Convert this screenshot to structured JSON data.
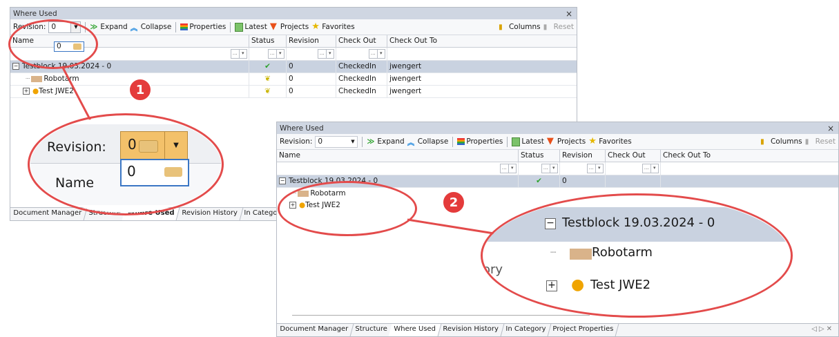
{
  "panel1": {
    "title": "Where Used",
    "close": "×",
    "toolbar": {
      "revision_label": "Revision:",
      "revision_value": "0",
      "expand": "Expand",
      "collapse": "Collapse",
      "properties": "Properties",
      "latest": "Latest",
      "projects": "Projects",
      "favorites": "Favorites",
      "columns": "Columns",
      "reset": "Reset"
    },
    "dropdown_option": "0",
    "columns": [
      "Name",
      "Status",
      "Revision",
      "Check Out",
      "Check Out To"
    ],
    "rows": [
      {
        "name": "Testblock 19.03.2024 - 0",
        "revision": "0",
        "checkout": "CheckedIn",
        "checkout_to": "jwengert"
      },
      {
        "name": "Robotarm",
        "revision": "0",
        "checkout": "CheckedIn",
        "checkout_to": "jwengert"
      },
      {
        "name": "Test JWE2",
        "revision": "0",
        "checkout": "CheckedIn",
        "checkout_to": "jwengert"
      }
    ],
    "tabs": [
      "Document Manager",
      "Structure",
      "Where Used",
      "Revision History",
      "In Category"
    ]
  },
  "panel2": {
    "title": "Where Used",
    "close": "×",
    "toolbar": {
      "revision_label": "Revision:",
      "revision_value": "0",
      "expand": "Expand",
      "collapse": "Collapse",
      "properties": "Properties",
      "latest": "Latest",
      "projects": "Projects",
      "favorites": "Favorites",
      "columns": "Columns",
      "reset": "Reset"
    },
    "columns": [
      "Name",
      "Status",
      "Revision",
      "Check Out",
      "Check Out To"
    ],
    "rows": [
      {
        "name": "Testblock 19.03.2024 - 0",
        "revision": "0"
      },
      {
        "name": "Robotarm"
      },
      {
        "name": "Test JWE2"
      }
    ],
    "tabs": [
      "Document Manager",
      "Structure",
      "Where Used",
      "Revision History",
      "In Category",
      "Project Properties"
    ]
  },
  "zoom1": {
    "revision_label": "Revision:",
    "revision_value": "0",
    "option": "0",
    "name_header": "Name"
  },
  "zoom2": {
    "row1": "Testblock 19.03.2024 - 0",
    "row2": "Robotarm",
    "row3": "Test JWE2",
    "peek": "ory"
  },
  "badges": {
    "one": "1",
    "two": "2"
  },
  "colors": {
    "annotation": "#e34b4b",
    "selected_row": "#c9d2e0",
    "titlebar": "#cfd6e2"
  }
}
